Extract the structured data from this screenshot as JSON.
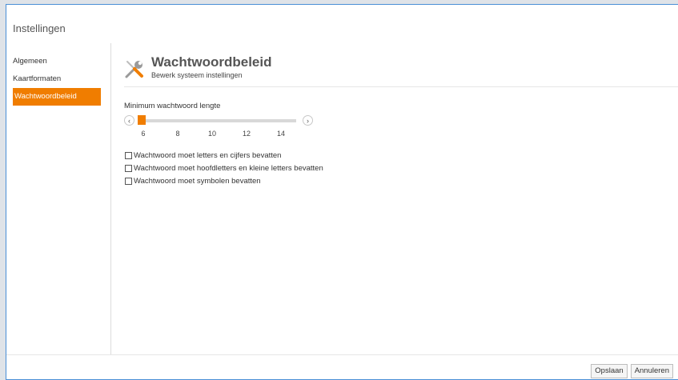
{
  "dialog": {
    "title": "Instellingen"
  },
  "sidebar": {
    "items": [
      {
        "label": "Algemeen",
        "active": false
      },
      {
        "label": "Kaartformaten",
        "active": false
      },
      {
        "label": "Wachtwoordbeleid",
        "active": true
      }
    ]
  },
  "header": {
    "icon": "tools-icon",
    "title": "Wachtwoordbeleid",
    "subtitle": "Bewerk systeem instellingen"
  },
  "slider": {
    "label": "Minimum wachtwoord lengte",
    "ticks": [
      "6",
      "8",
      "10",
      "12",
      "14"
    ],
    "min": 6,
    "max": 14,
    "value": 6,
    "left_icon": "chevron-left-icon",
    "right_icon": "chevron-right-icon"
  },
  "checkboxes": [
    {
      "label": "Wachtwoord moet letters en cijfers bevatten",
      "checked": false
    },
    {
      "label": "Wachtwoord moet hoofdletters en kleine letters bevatten",
      "checked": false
    },
    {
      "label": "Wachtwoord moet symbolen bevatten",
      "checked": false
    }
  ],
  "footer": {
    "save_label": "Opslaan",
    "cancel_label": "Annuleren"
  },
  "colors": {
    "accent": "#f07d00",
    "border": "#4a8fd6"
  }
}
